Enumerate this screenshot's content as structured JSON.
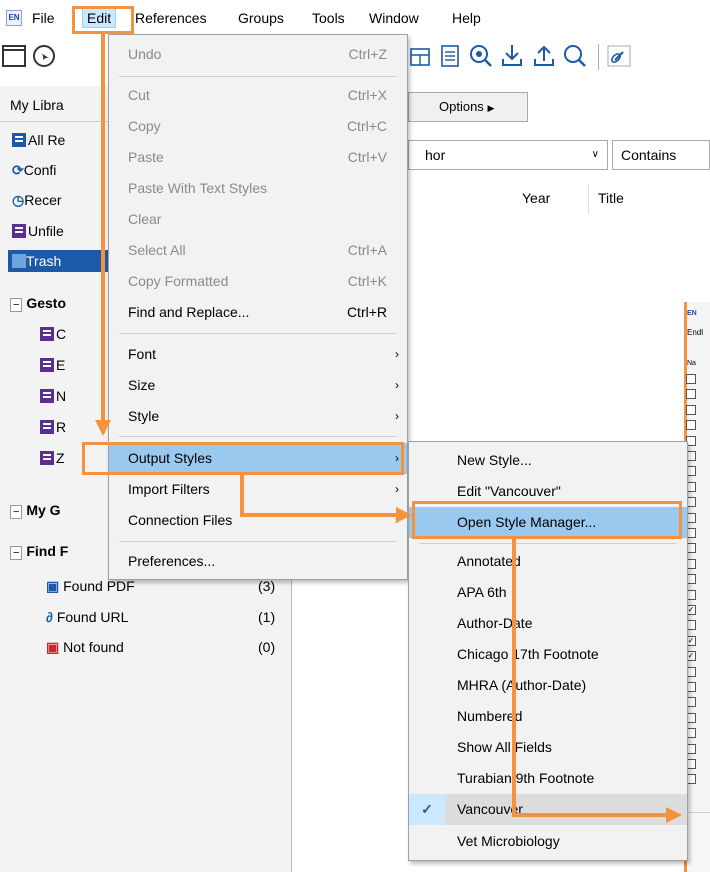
{
  "menubar": {
    "logo": "EN",
    "items": [
      "File",
      "Edit",
      "References",
      "Groups",
      "Tools",
      "Window",
      "Help"
    ]
  },
  "toolbar": {
    "icons": [
      "folder-icon",
      "globe-icon",
      "table-icon",
      "add-reference-icon",
      "online-search-icon",
      "import-icon",
      "export-icon",
      "find-pdf-icon",
      "link-icon"
    ]
  },
  "library_panel": {
    "tab_label": "My Libra",
    "items": [
      {
        "label": "All Re"
      },
      {
        "label": "Confi"
      },
      {
        "label": "Recer"
      },
      {
        "label": "Unfile"
      },
      {
        "label": "Trash"
      }
    ],
    "group_set": {
      "label": "Gesto",
      "groups": [
        "C",
        "E",
        "N",
        "R",
        "Z"
      ]
    },
    "my_groups_label": "My G",
    "find_full_text": {
      "label": "Find F",
      "items": [
        {
          "label": "Found PDF",
          "count": "(3)"
        },
        {
          "label": "Found URL",
          "count": "(1)"
        },
        {
          "label": "Not found",
          "count": "(0)"
        }
      ]
    }
  },
  "search": {
    "options_label": "Options",
    "field_value": "hor",
    "operator_value": "Contains"
  },
  "columns": {
    "year": "Year",
    "title": "Title"
  },
  "edit_menu": {
    "items": [
      {
        "label": "Undo",
        "shortcut": "Ctrl+Z",
        "disabled": true
      },
      {
        "label": "Cut",
        "shortcut": "Ctrl+X",
        "disabled": true
      },
      {
        "label": "Copy",
        "shortcut": "Ctrl+C",
        "disabled": true
      },
      {
        "label": "Paste",
        "shortcut": "Ctrl+V",
        "disabled": true
      },
      {
        "label": "Paste With Text Styles",
        "shortcut": "",
        "disabled": true
      },
      {
        "label": "Clear",
        "shortcut": "",
        "disabled": true
      },
      {
        "label": "Select All",
        "shortcut": "Ctrl+A",
        "disabled": true
      },
      {
        "label": "Copy Formatted",
        "shortcut": "Ctrl+K",
        "disabled": true
      },
      {
        "label": "Find and Replace...",
        "shortcut": "Ctrl+R",
        "disabled": false
      },
      {
        "label": "Font",
        "submenu": true
      },
      {
        "label": "Size",
        "submenu": true
      },
      {
        "label": "Style",
        "submenu": true
      },
      {
        "label": "Output Styles",
        "submenu": true,
        "highlighted": true
      },
      {
        "label": "Import Filters",
        "submenu": true
      },
      {
        "label": "Connection Files",
        "submenu": true
      },
      {
        "label": "Preferences..."
      }
    ]
  },
  "output_styles_menu": {
    "items": [
      {
        "label": "New Style..."
      },
      {
        "label": "Edit \"Vancouver\""
      },
      {
        "label": "Open Style Manager...",
        "highlighted": true
      },
      {
        "label": "Annotated"
      },
      {
        "label": "APA 6th"
      },
      {
        "label": "Author-Date"
      },
      {
        "label": "Chicago 17th Footnote"
      },
      {
        "label": "MHRA (Author-Date)"
      },
      {
        "label": "Numbered"
      },
      {
        "label": "Show All Fields"
      },
      {
        "label": "Turabian 9th Footnote"
      },
      {
        "label": "Vancouver",
        "checked": true
      },
      {
        "label": "Vet Microbiology"
      }
    ]
  },
  "style_manager_preview": {
    "title_fragment": "Endl",
    "column_fragment": "Na",
    "checked_rows": [
      15,
      17,
      18
    ]
  },
  "colors": {
    "highlight": "#99c9ef",
    "annotation": "#f5923e",
    "selection": "#cce8ff"
  }
}
